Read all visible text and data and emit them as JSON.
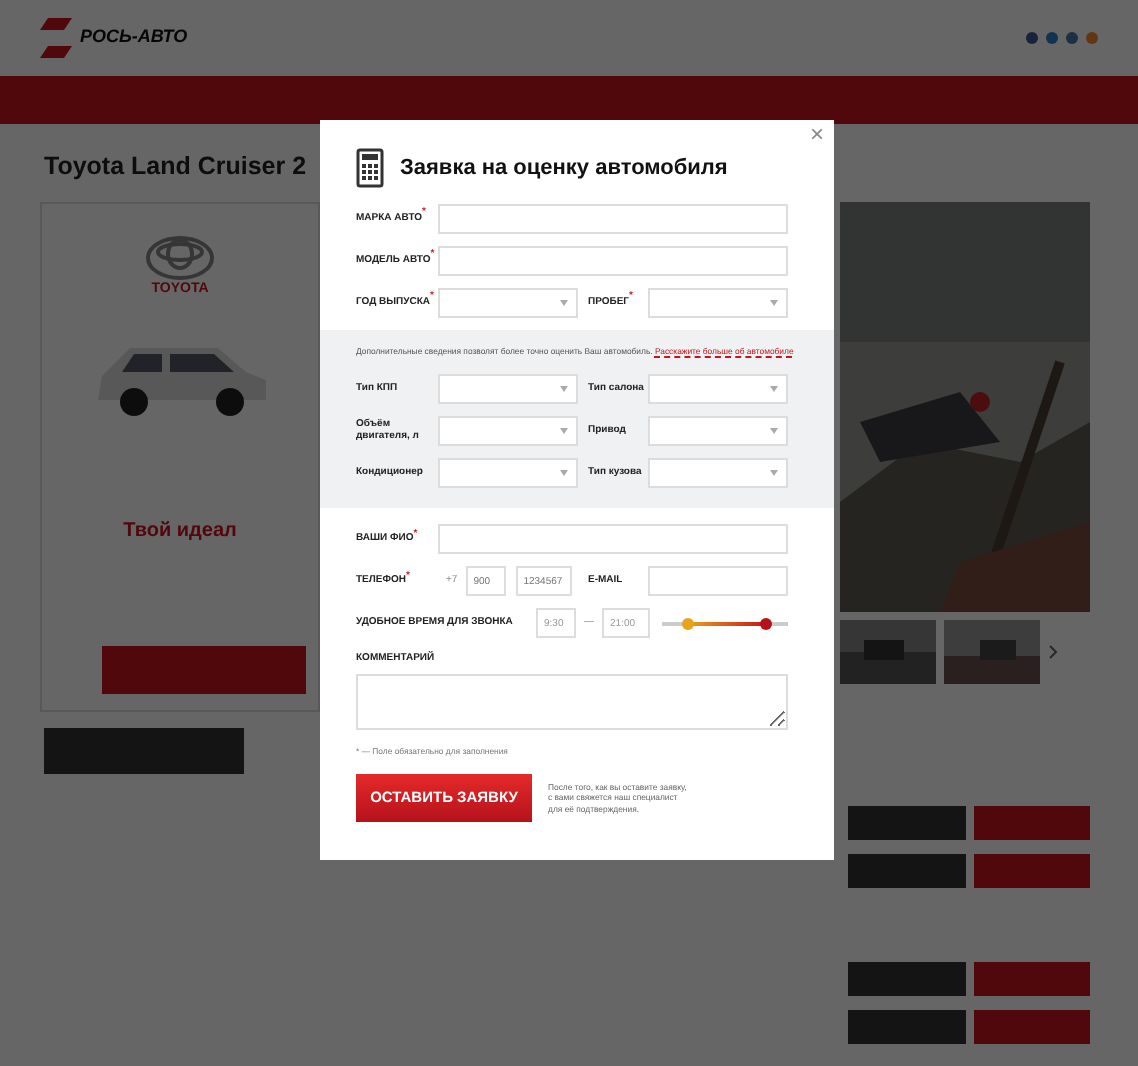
{
  "header": {
    "logo": "РОСЬ-АВТО"
  },
  "page": {
    "title": "Toyota Land Cruiser 2",
    "brand": "TOYOTA",
    "slogan": "Твой идеал"
  },
  "modal": {
    "close": "×",
    "title": "Заявка на оценку автомобиля",
    "main": [
      [
        {
          "kind": "text",
          "label": "МАРКА АВТО$^{*}$"
        }
      ],
      [
        {
          "kind": "text",
          "label": "МОДЕЛЬ АВТО$^{*}$"
        }
      ],
      [
        {
          "kind": "select",
          "label": "ГОД ВЫПУСКА$^{*}$"
        },
        {
          "kind": "select",
          "label": "ПРОБЕГ$^{*}$"
        }
      ]
    ],
    "extra": {
      "note": "Дополнительные сведения позволят более точно оценить Ваш автомобиль.",
      "link": "Расскажите больше об автомобиле",
      "rows": [
        [
          {
            "kind": "select",
            "label": "Тип КПП"
          },
          {
            "kind": "select",
            "label": "Тип салона"
          }
        ],
        [
          {
            "kind": "select",
            "label": "Объём двигателя, л"
          },
          {
            "kind": "select",
            "label": "Привод"
          }
        ],
        [
          {
            "kind": "select",
            "label": "Кондиционер"
          },
          {
            "kind": "select",
            "label": "Тип кузова"
          }
        ]
      ]
    },
    "contact": [
      [
        {
          "kind": "text",
          "label": "ВАШИ ФИО$^{*}$"
        }
      ],
      [
        {
          "kind": "phone",
          "label": "ТЕЛЕФОН$^{*}$",
          "prefix": "+7",
          "placeholders": [
            "900",
            "1234567"
          ]
        },
        {
          "kind": "text",
          "label": "E-MAIL"
        }
      ]
    ],
    "call_time": {
      "label": "УДОБНОЕ ВРЕМЯ ДЛЯ ЗВОНКА",
      "from": "9:30",
      "dash": "—",
      "to": "21:00",
      "slider": {
        "start": {
          "level": 0.2
        },
        "end": {
          "level": 0.83
        }
      }
    },
    "comment": {
      "label": "КОММЕНТАРИЙ"
    },
    "required_note": "* — Поле обязательно для заполнения",
    "submit": "ОСТАВИТЬ ЗАЯВКУ",
    "submit_note": "После того, как вы оставите заявку, с вами свяжется наш специалист для её подтверждения."
  }
}
